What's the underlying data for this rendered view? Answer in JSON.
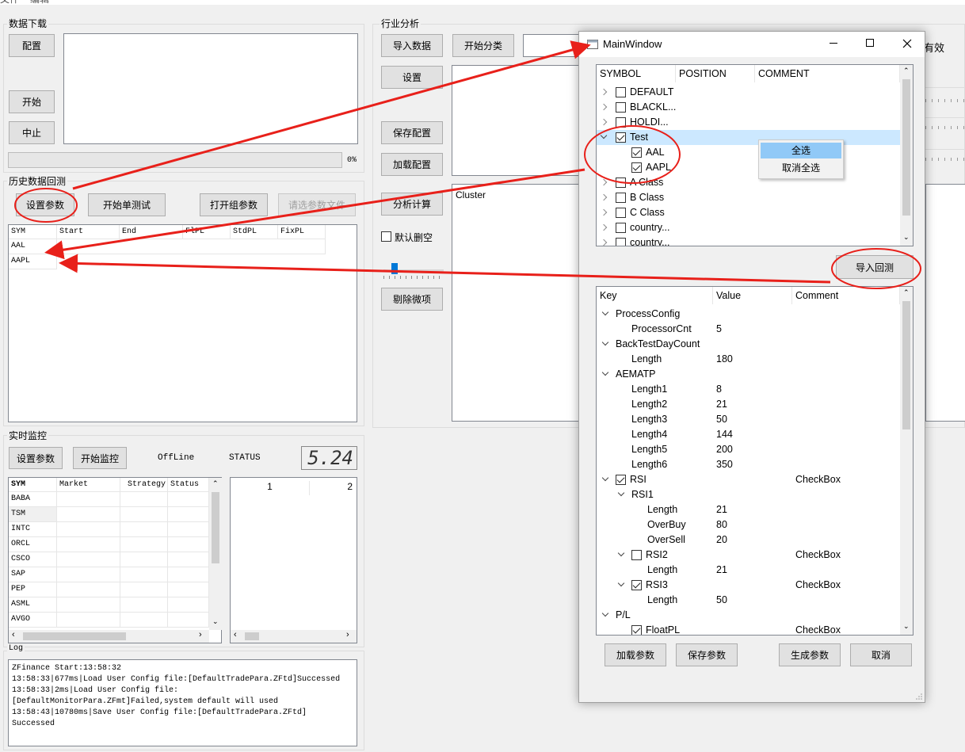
{
  "menu": [
    "文件",
    "编辑"
  ],
  "download": {
    "title": "数据下载",
    "config": "配置",
    "start": "开始",
    "stop": "中止",
    "progress": "0%",
    "progress_value": 0
  },
  "backtest": {
    "title": "历史数据回测",
    "set_params": "设置参数",
    "single_test": "开始单测试",
    "open_group": "打开组参数",
    "select_file": "请选参数文件",
    "columns": [
      "SYM",
      "Start",
      "End",
      "FlPL",
      "StdPL",
      "FixPL"
    ],
    "rows": [
      "AAL",
      "AAPL"
    ]
  },
  "industry": {
    "title": "行业分析",
    "import_data": "导入数据",
    "start_classify": "开始分类",
    "settings": "设置",
    "save_config": "保存配置",
    "load_config": "加载配置",
    "analyze": "分析计算",
    "default_clear": "默认删空",
    "remove_minor": "剔除微项",
    "cluster": "Cluster",
    "effective_partial": "有效"
  },
  "monitor": {
    "title": "实时监控",
    "set_params": "设置参数",
    "start_monitor": "开始监控",
    "offline": "OffLine",
    "status": "STATUS",
    "lcd": "5.24",
    "columns": [
      "SYM",
      "Market",
      "Strategy",
      "Status"
    ],
    "rows": [
      "BABA",
      "TSM",
      "INTC",
      "ORCL",
      "CSCO",
      "SAP",
      "PEP",
      "ASML",
      "AVGO"
    ],
    "right_cols": [
      "1",
      "2"
    ]
  },
  "log": {
    "title": "Log",
    "lines": [
      "ZFinance Start:13:58:32",
      "13:58:33|677ms|Load User Config file:[DefaultTradePara.ZFtd]Successed",
      "13:58:33|2ms|Load User Config file:",
      "[DefaultMonitorPara.ZFmt]Failed,system default will used",
      "13:58:43|10780ms|Save User Config file:[DefaultTradePara.ZFtd]",
      "Successed"
    ]
  },
  "dialog": {
    "title": "MainWindow",
    "symbol_headers": [
      "SYMBOL",
      "POSITION",
      "COMMENT"
    ],
    "symbols": [
      {
        "label": "DEFAULT",
        "checked": false,
        "level": 0,
        "expand": "collapsed"
      },
      {
        "label": "BLACKL...",
        "checked": false,
        "level": 0,
        "expand": "collapsed"
      },
      {
        "label": "HOLDI...",
        "checked": false,
        "level": 0,
        "expand": "collapsed"
      },
      {
        "label": "Test",
        "checked": true,
        "level": 0,
        "expand": "expanded"
      },
      {
        "label": "AAL",
        "checked": true,
        "level": 1,
        "expand": "none"
      },
      {
        "label": "AAPL",
        "checked": true,
        "level": 1,
        "expand": "none"
      },
      {
        "label": "A Class",
        "checked": false,
        "level": 0,
        "expand": "collapsed"
      },
      {
        "label": "B Class",
        "checked": false,
        "level": 0,
        "expand": "collapsed"
      },
      {
        "label": "C Class",
        "checked": false,
        "level": 0,
        "expand": "collapsed"
      },
      {
        "label": "country...",
        "checked": false,
        "level": 0,
        "expand": "collapsed"
      },
      {
        "label": "country...",
        "checked": false,
        "level": 0,
        "expand": "collapsed"
      }
    ],
    "context_menu": [
      "全选",
      "取消全选"
    ],
    "import_backtest": "导入回测",
    "param_headers": [
      "Key",
      "Value",
      "Comment"
    ],
    "params": [
      {
        "key": "ProcessConfig",
        "value": "",
        "comment": "",
        "level": 0,
        "expand": true,
        "check": null
      },
      {
        "key": "ProcessorCnt",
        "value": "5",
        "comment": "",
        "level": 1,
        "expand": null,
        "check": null
      },
      {
        "key": "BackTestDayCount",
        "value": "",
        "comment": "",
        "level": 0,
        "expand": true,
        "check": null
      },
      {
        "key": "Length",
        "value": "180",
        "comment": "",
        "level": 1,
        "expand": null,
        "check": null
      },
      {
        "key": "AEMATP",
        "value": "",
        "comment": "",
        "level": 0,
        "expand": true,
        "check": null
      },
      {
        "key": "Length1",
        "value": "8",
        "comment": "",
        "level": 1,
        "expand": null,
        "check": null
      },
      {
        "key": "Length2",
        "value": "21",
        "comment": "",
        "level": 1,
        "expand": null,
        "check": null
      },
      {
        "key": "Length3",
        "value": "50",
        "comment": "",
        "level": 1,
        "expand": null,
        "check": null
      },
      {
        "key": "Length4",
        "value": "144",
        "comment": "",
        "level": 1,
        "expand": null,
        "check": null
      },
      {
        "key": "Length5",
        "value": "200",
        "comment": "",
        "level": 1,
        "expand": null,
        "check": null
      },
      {
        "key": "Length6",
        "value": "350",
        "comment": "",
        "level": 1,
        "expand": null,
        "check": null
      },
      {
        "key": "RSI",
        "value": "",
        "comment": "CheckBox",
        "level": 0,
        "expand": true,
        "check": true
      },
      {
        "key": "RSI1",
        "value": "",
        "comment": "",
        "level": 1,
        "expand": true,
        "check": null
      },
      {
        "key": "Length",
        "value": "21",
        "comment": "",
        "level": 2,
        "expand": null,
        "check": null
      },
      {
        "key": "OverBuy",
        "value": "80",
        "comment": "",
        "level": 2,
        "expand": null,
        "check": null
      },
      {
        "key": "OverSell",
        "value": "20",
        "comment": "",
        "level": 2,
        "expand": null,
        "check": null
      },
      {
        "key": "RSI2",
        "value": "",
        "comment": "CheckBox",
        "level": 1,
        "expand": true,
        "check": false
      },
      {
        "key": "Length",
        "value": "21",
        "comment": "",
        "level": 2,
        "expand": null,
        "check": null
      },
      {
        "key": "RSI3",
        "value": "",
        "comment": "CheckBox",
        "level": 1,
        "expand": true,
        "check": true
      },
      {
        "key": "Length",
        "value": "50",
        "comment": "",
        "level": 2,
        "expand": null,
        "check": null
      },
      {
        "key": "P/L",
        "value": "",
        "comment": "",
        "level": 0,
        "expand": true,
        "check": null
      },
      {
        "key": "FloatPL",
        "value": "",
        "comment": "CheckBox",
        "level": 1,
        "expand": null,
        "check": true
      }
    ],
    "load_params": "加载参数",
    "save_params": "保存参数",
    "generate_params": "生成参数",
    "cancel": "取消"
  },
  "colors": {
    "annotation": "#e8201a",
    "selection": "#cce8ff",
    "menu_highlight": "#91c9f7"
  }
}
